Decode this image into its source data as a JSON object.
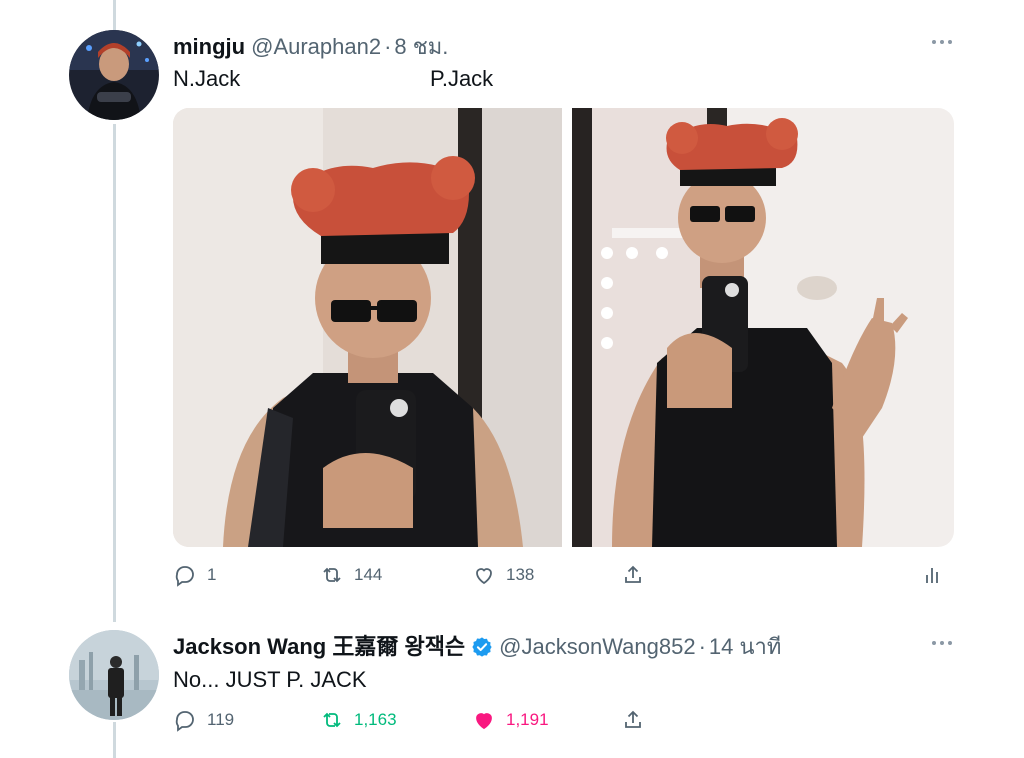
{
  "colors": {
    "text_primary": "#0f1419",
    "text_secondary": "#536471",
    "thread_line": "#cfd9de",
    "retweet_active": "#00ba7c",
    "like_active": "#f91880",
    "verified": "#1d9bf0"
  },
  "tweet1": {
    "author_name": "mingju",
    "handle": "@Auraphan2",
    "separator": "·",
    "time": "8 ชม.",
    "text_left": "N.Jack",
    "text_right": "P.Jack",
    "reply_count": "1",
    "retweet_count": "144",
    "like_count": "138",
    "icons": [
      "reply-icon",
      "retweet-icon",
      "like-icon",
      "share-icon",
      "analytics-icon",
      "more-icon"
    ]
  },
  "tweet2": {
    "author_name": "Jackson Wang 王嘉爾 왕잭슨",
    "handle": "@JacksonWang852",
    "separator": "·",
    "time": "14 นาที",
    "text": "No... JUST P. JACK",
    "reply_count": "119",
    "retweet_count": "1,163",
    "like_count": "1,191",
    "retweeted": true,
    "liked": true,
    "verified": true,
    "icons": [
      "reply-icon",
      "retweet-icon",
      "like-icon",
      "share-icon",
      "verified-badge-icon",
      "more-icon"
    ]
  }
}
